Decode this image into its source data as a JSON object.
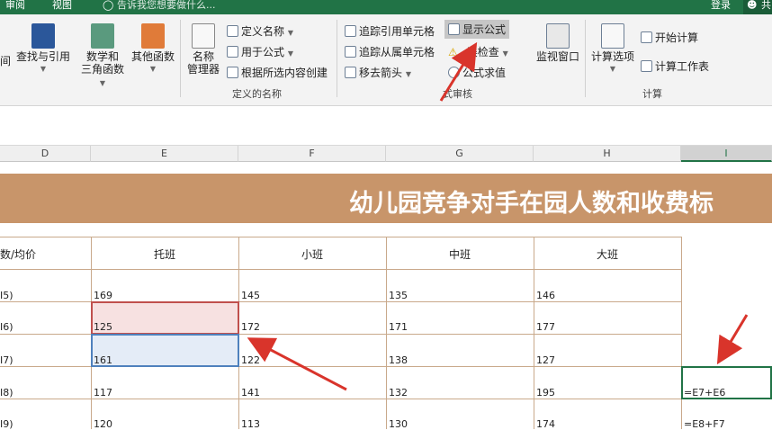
{
  "topbar": {
    "tab_review": "审阅",
    "tab_view": "视图",
    "tell_me": "告诉我您想要做什么...",
    "login": "登录",
    "share": "共"
  },
  "ribbon": {
    "partial_label": "间",
    "lookup": "查找与引用",
    "math": "数学和三角函数",
    "math_l1": "数学和",
    "math_l2": "三角函数",
    "other": "其他函数",
    "name_mgr_l1": "名称",
    "name_mgr_l2": "管理器",
    "define_name": "定义名称",
    "use_in_formula": "用于公式",
    "create_from_sel": "根据所选内容创建",
    "group_defined_names": "定义的名称",
    "trace_precedents": "追踪引用单元格",
    "trace_dependents": "追踪从属单元格",
    "remove_arrows": "移去箭头",
    "show_formulas": "显示公式",
    "error_check": "错误检查",
    "error_check_partial": "误检查",
    "evaluate_formula": "公式求值",
    "group_formula_audit": "公式审核",
    "group_formula_audit_partial": "式审核",
    "watch_window": "监视窗口",
    "calc_options": "计算选项",
    "calc_now": "开始计算",
    "calc_sheet": "计算工作表",
    "group_calc": "计算"
  },
  "columns": [
    "D",
    "E",
    "F",
    "G",
    "H",
    "I"
  ],
  "sheet": {
    "title": "幼儿园竞争对手在园人数和收费标",
    "header_row": [
      "数/均价",
      "托班",
      "小班",
      "中班",
      "大班"
    ],
    "rows": [
      {
        "label": "I5)",
        "values": [
          "169",
          "145",
          "135",
          "146"
        ],
        "formula": ""
      },
      {
        "label": "I6)",
        "values": [
          "125",
          "172",
          "171",
          "177"
        ],
        "formula": ""
      },
      {
        "label": "I7)",
        "values": [
          "161",
          "122",
          "138",
          "127"
        ],
        "formula": ""
      },
      {
        "label": "I8)",
        "values": [
          "117",
          "141",
          "132",
          "195"
        ],
        "formula": "=E7+E6"
      },
      {
        "label": "I9)",
        "values": [
          "120",
          "113",
          "130",
          "174"
        ],
        "formula": "=E8+F7"
      }
    ]
  },
  "colors": {
    "excel_green": "#217346",
    "title_band": "#c8956a",
    "precedent_red": "#e6b8b7",
    "precedent_blue": "#dbe5f1",
    "arrow_red": "#d9342b"
  }
}
